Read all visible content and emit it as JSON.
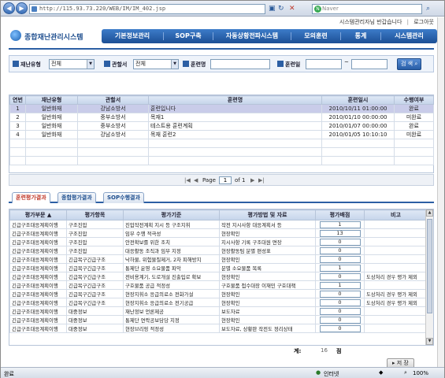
{
  "browser": {
    "url": "http://115.93.73.220/WEB/IM/IM_402.jsp",
    "search_placeholder": "Naver",
    "status_left": "완료",
    "status_zone": "인터넷",
    "zoom": "100%"
  },
  "top_links": [
    "시스템관리자님 반갑습니다",
    "로그아웃"
  ],
  "logo": "종합재난관리시스템",
  "menu": [
    "기본정보관리",
    "SOP구축",
    "자동상황전파시스템",
    "모의훈련",
    "통계",
    "시스템관리"
  ],
  "filter": {
    "disaster_type_label": "재난유형",
    "disaster_type_value": "전체",
    "agency_label": "관할서",
    "agency_value": "전체",
    "training_name_label": "훈련명",
    "training_date_label": "훈련일",
    "range_dash": "~",
    "search_button": "검 색"
  },
  "list_table": {
    "headers": [
      "연번",
      "재난유형",
      "관할서",
      "훈련명",
      "훈련일시",
      "수행여부"
    ],
    "rows": [
      [
        "1",
        "일반화재",
        "강남소방서",
        "훈련입니다",
        "2010/10/11 01:00:00",
        "완료"
      ],
      [
        "2",
        "일반화재",
        "중부소방서",
        "목재1",
        "2010/01/10 00:00:00",
        "미완료"
      ],
      [
        "3",
        "일반화재",
        "중부소방서",
        "테스트용 훈련계획",
        "2010/01/07 00:00:00",
        "완료"
      ],
      [
        "4",
        "일반화재",
        "강남소방서",
        "목재 훈련2",
        "2010/01/05 10:10:10",
        "미완료"
      ]
    ]
  },
  "pager": {
    "page_label": "Page",
    "page_value": "1",
    "of_label": "of 1"
  },
  "tabs": [
    "훈련평가결과",
    "종합평가결과",
    "SOP수행결과"
  ],
  "eval_table": {
    "headers": [
      "평가부문 ▲",
      "평가항목",
      "평가기준",
      "평가방법 및 자료",
      "평가배점",
      "비고"
    ],
    "rows": [
      [
        "긴급구조대응계획이행",
        "구조진압",
        "진압작전계획 지시 등 구조지휘",
        "작전 지시사항 대응계획서 등",
        "1",
        ""
      ],
      [
        "긴급구조대응계획이행",
        "구조진압",
        "임무 수행 적극성",
        "현장확인",
        "13",
        ""
      ],
      [
        "긴급구조대응계획이행",
        "구조진압",
        "안전확보를 위한 조치",
        "지시사항 기록 구조대원 면장",
        "0",
        ""
      ],
      [
        "긴급구조대응계획이행",
        "구조진압",
        "대응활동 조직과 임무 지정",
        "현장활동팀 분별 편성표",
        "0",
        ""
      ],
      [
        "긴급구조대응계획이행",
        "긴급복구긴급구조",
        "낙하물, 위험물질제거, 2차 피해방지",
        "현장확인",
        "0",
        ""
      ],
      [
        "긴급구조대응계획이행",
        "긴급복구긴급구조",
        "통제단 운영 소요물품 파악",
        "분별 소요물품 목록",
        "1",
        ""
      ],
      [
        "긴급구조대응계획이행",
        "긴급복구긴급구조",
        "전비용계기, 도로개설 진출입로 확보",
        "현장확인",
        "0",
        "도상처리 경우 평가 제외"
      ],
      [
        "긴급구조대응계획이행",
        "긴급복구긴급구조",
        "구호물품 공급 적정성",
        "구호물품 접수대장 이재민 구호대책",
        "1",
        ""
      ],
      [
        "긴급구조대응계획이행",
        "긴급복구긴급구조",
        "현장지휘소 응급의료소 전화가설",
        "현장확인",
        "0",
        "도상처리 경우 평가 제외"
      ],
      [
        "긴급구조대응계획이행",
        "긴급복구긴급구조",
        "현장지휘소 응급의료소 전기공급",
        "현장확인",
        "0",
        "도상처리 경우 평가 제외"
      ],
      [
        "긴급구조대응계획이행",
        "대중정보",
        "재난정보 언론제공",
        "보도자료",
        "0",
        ""
      ],
      [
        "긴급구조대응계획이행",
        "대중정보",
        "통제단 연락공보담당 지정",
        "현장확인",
        "0",
        ""
      ],
      [
        "긴급구조대응계획이행",
        "대중정보",
        "현장브리핑 적정성",
        "보도자료, 상황판 작전도 정리상태",
        "0",
        ""
      ]
    ]
  },
  "total": {
    "label": "계:",
    "value": "16",
    "unit": "점"
  },
  "save_button": "저 장"
}
